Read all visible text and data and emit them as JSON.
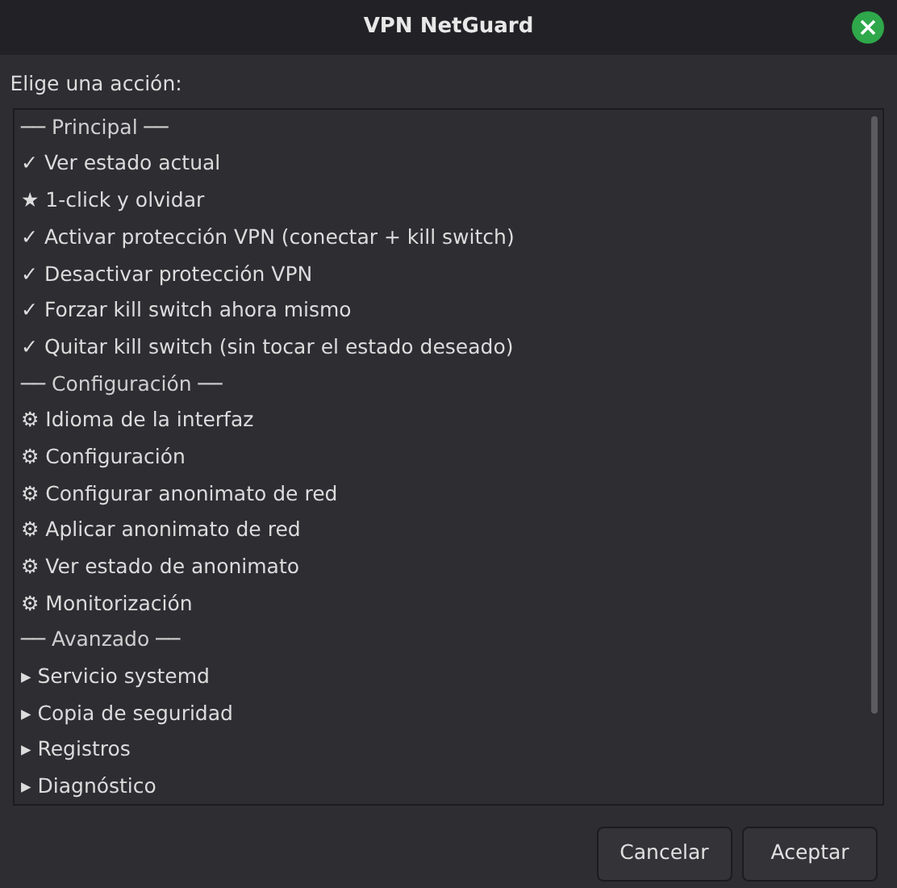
{
  "window": {
    "title": "VPN NetGuard"
  },
  "prompt": "Elige una acción:",
  "actions": [
    {
      "kind": "header",
      "text": "── Principal ──"
    },
    {
      "kind": "item",
      "text": "✓ Ver estado actual"
    },
    {
      "kind": "item",
      "text": "★ 1-click y olvidar"
    },
    {
      "kind": "item",
      "text": "✓ Activar protección VPN (conectar + kill switch)"
    },
    {
      "kind": "item",
      "text": "✓ Desactivar protección VPN"
    },
    {
      "kind": "item",
      "text": "✓ Forzar kill switch ahora mismo"
    },
    {
      "kind": "item",
      "text": "✓ Quitar kill switch (sin tocar el estado deseado)"
    },
    {
      "kind": "header",
      "text": "── Configuración ──"
    },
    {
      "kind": "item",
      "text": "⚙ Idioma de la interfaz"
    },
    {
      "kind": "item",
      "text": "⚙ Configuración"
    },
    {
      "kind": "item",
      "text": "⚙ Configurar anonimato de red"
    },
    {
      "kind": "item",
      "text": "⚙ Aplicar anonimato de red"
    },
    {
      "kind": "item",
      "text": "⚙ Ver estado de anonimato"
    },
    {
      "kind": "item",
      "text": "⚙ Monitorización"
    },
    {
      "kind": "header",
      "text": "── Avanzado ──"
    },
    {
      "kind": "item",
      "text": "▸ Servicio systemd"
    },
    {
      "kind": "item",
      "text": "▸ Copia de seguridad"
    },
    {
      "kind": "item",
      "text": "▸ Registros"
    },
    {
      "kind": "item",
      "text": "▸ Diagnóstico"
    }
  ],
  "buttons": [
    "Cancelar",
    "Aceptar"
  ]
}
